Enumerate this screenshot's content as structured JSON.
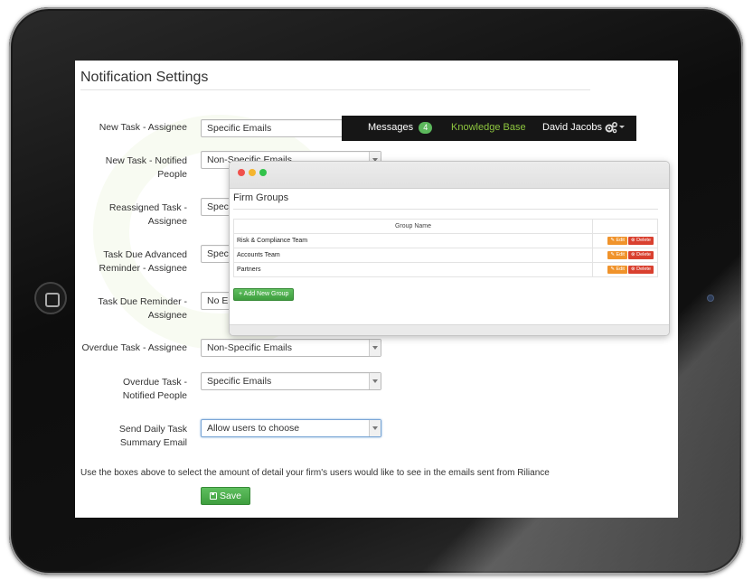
{
  "page": {
    "title": "Notification Settings",
    "help_text": "Use the boxes above to select the amount of detail your firm's users would like to see in the emails sent from Riliance",
    "save_label": "Save"
  },
  "settings": [
    {
      "label": "New Task - Assignee",
      "value": "Specific Emails"
    },
    {
      "label": "New Task - Notified People",
      "value": "Non-Specific Emails"
    },
    {
      "label": "Reassigned Task - Assignee",
      "value": "Spec"
    },
    {
      "label": "Task Due Advanced Reminder - Assignee",
      "value": "Spec"
    },
    {
      "label": "Task Due Reminder - Assignee",
      "value": "No E"
    },
    {
      "label": "Overdue Task - Assignee",
      "value": "Non-Specific Emails"
    },
    {
      "label": "Overdue Task - Notified People",
      "value": "Specific Emails"
    },
    {
      "label": "Send Daily Task Summary Email",
      "value": "Allow users to choose"
    }
  ],
  "navbar": {
    "messages_label": "Messages",
    "messages_count": "4",
    "knowledge_base": "Knowledge Base",
    "user_name": "David Jacobs",
    "colors": {
      "background": "#161616",
      "kb_link": "#8ec63f",
      "badge": "#5cb85c"
    }
  },
  "firm_groups": {
    "title": "Firm Groups",
    "column_header": "Group Name",
    "rows": [
      {
        "name": "Risk & Compliance Team",
        "edit": "Edit",
        "delete": "Delete"
      },
      {
        "name": "Accounts Team",
        "edit": "Edit",
        "delete": "Delete"
      },
      {
        "name": "Partners",
        "edit": "Edit",
        "delete": "Delete"
      }
    ],
    "add_label": "+ Add New Group"
  },
  "icons": [
    "gear-icon",
    "chevron-down-icon",
    "floppy-icon",
    "home-button",
    "camera"
  ]
}
